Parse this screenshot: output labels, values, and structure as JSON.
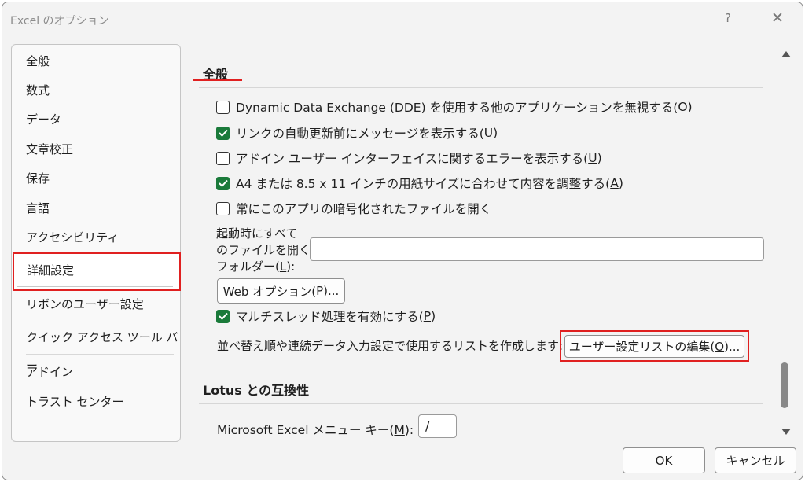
{
  "window": {
    "title": "Excel のオプション",
    "help_label": "?",
    "close_label": "✕"
  },
  "sidebar": {
    "items": [
      {
        "label": "全般"
      },
      {
        "label": "数式"
      },
      {
        "label": "データ"
      },
      {
        "label": "文章校正"
      },
      {
        "label": "保存"
      },
      {
        "label": "言語"
      },
      {
        "label": "アクセシビリティ"
      },
      {
        "label": "詳細設定",
        "selected": true
      },
      {
        "label": "リボンのユーザー設定"
      },
      {
        "label": "クイック アクセス ツール バー"
      },
      {
        "label": "アドイン"
      },
      {
        "label": "トラスト センター"
      }
    ]
  },
  "main": {
    "section_general": "全般",
    "options": [
      {
        "label_pre": "Dynamic Data Exchange (DDE) を使用する他のアプリケーションを無視する(",
        "key": "O",
        "label_post": ")",
        "checked": false
      },
      {
        "label_pre": "リンクの自動更新前にメッセージを表示する(",
        "key": "U",
        "label_post": ")",
        "checked": true
      },
      {
        "label_pre": "アドイン ユーザー インターフェイスに関するエラーを表示する(",
        "key": "U",
        "label_post": ")",
        "checked": false
      },
      {
        "label_pre": "A4 または 8.5 x 11 インチの用紙サイズに合わせて内容を調整する(",
        "key": "A",
        "label_post": ")",
        "checked": true
      },
      {
        "label_pre": "常にこのアプリの暗号化されたファイルを開く",
        "key": "",
        "label_post": "",
        "checked": false
      }
    ],
    "startup_label_line1": "起動時にすべて",
    "startup_label_line2": "のファイルを開く",
    "startup_label_line3_pre": "フォルダー(",
    "startup_label_line3_key": "L",
    "startup_label_line3_post": "):",
    "startup_value": "",
    "web_options_pre": "Web オプション(",
    "web_options_key": "P",
    "web_options_post": ")...",
    "multithread": {
      "label_pre": "マルチスレッド処理を有効にする(",
      "key": "P",
      "label_post": ")",
      "checked": true
    },
    "custom_list_text": "並べ替え順や連続データ入力設定で使用するリストを作成します:",
    "custom_list_button_pre": "ユーザー設定リストの編集(",
    "custom_list_button_key": "O",
    "custom_list_button_post": ")...",
    "section_lotus": "Lotus との互換性",
    "menu_key_label_pre": "Microsoft Excel メニュー キー(",
    "menu_key_label_key": "M",
    "menu_key_label_post": "):",
    "menu_key_value": "/"
  },
  "footer": {
    "ok_label": "OK",
    "cancel_label": "キャンセル"
  },
  "colors": {
    "highlight_red": "#e02020",
    "checkbox_green": "#1a7a3a"
  }
}
